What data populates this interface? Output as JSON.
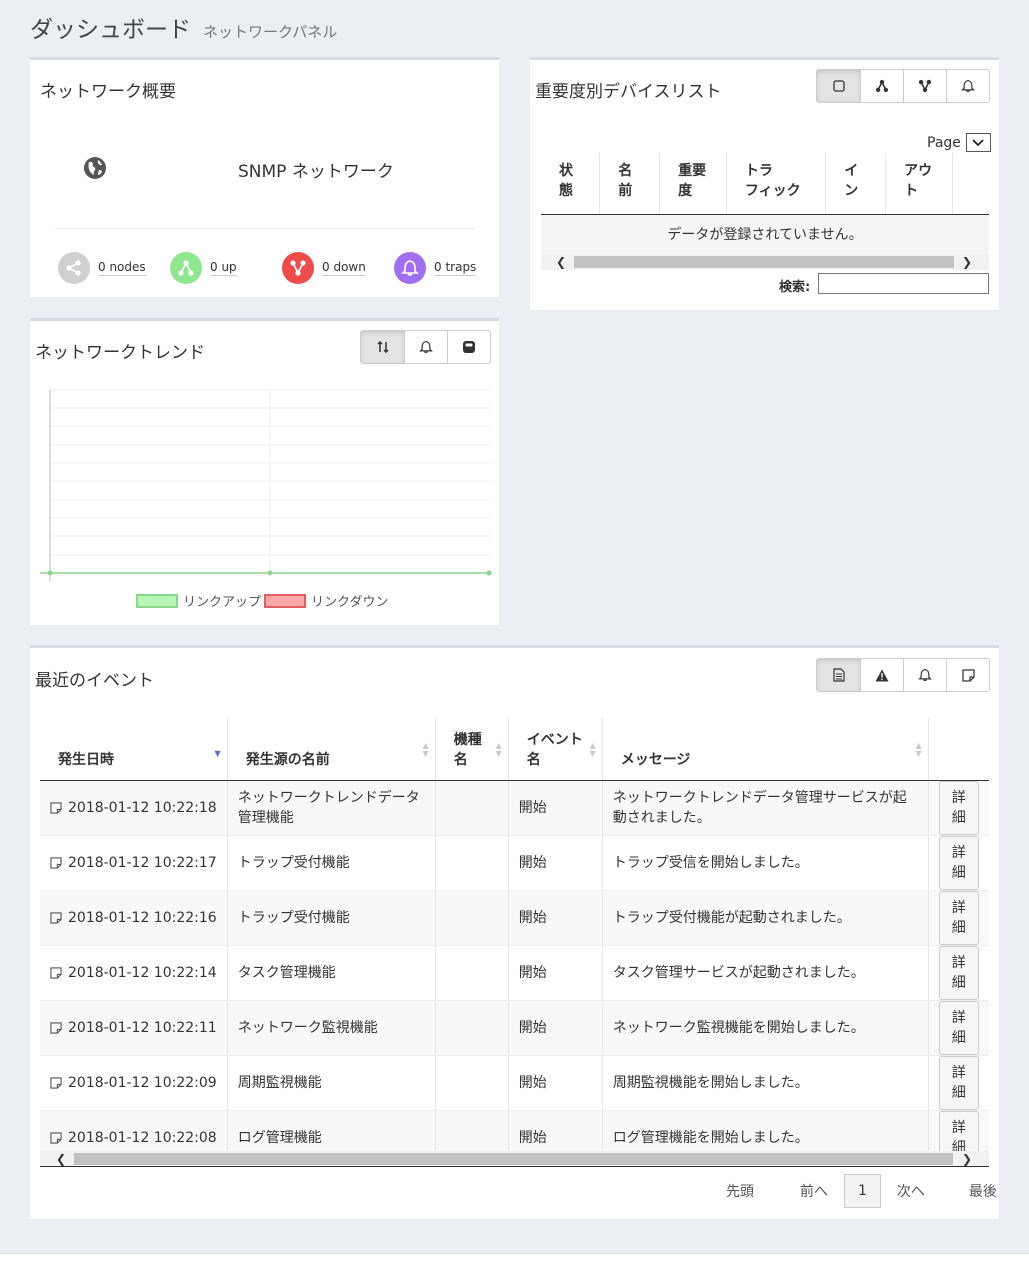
{
  "header": {
    "title": "ダッシュボード",
    "subtitle": "ネットワークパネル"
  },
  "overview": {
    "title": "ネットワーク概要",
    "network_label": "SNMP ネットワーク",
    "stats": [
      {
        "label": "0 nodes",
        "color": "#d0d0d0",
        "icon": "nodes-icon"
      },
      {
        "label": "0 up",
        "color": "#8ee68e",
        "icon": "up-icon"
      },
      {
        "label": "0 down",
        "color": "#f04b4b",
        "icon": "down-icon"
      },
      {
        "label": "0 traps",
        "color": "#a06ef0",
        "icon": "bell-icon"
      }
    ]
  },
  "devices": {
    "title": "重要度別デバイスリスト",
    "page_label": "Page",
    "columns": [
      "状態",
      "名前",
      "重要度",
      "トラフィック",
      "イン",
      "アウト"
    ],
    "empty_text": "データが登録されていません。",
    "search_label": "検索:"
  },
  "trend": {
    "title": "ネットワークトレンド",
    "legend": [
      {
        "label": "リンクアップ",
        "color": "#b6f5b6",
        "border": "#8ad68a"
      },
      {
        "label": "リンクダウン",
        "color": "#f8a8a8",
        "border": "#e06060"
      }
    ]
  },
  "events": {
    "title": "最近のイベント",
    "columns": [
      "発生日時",
      "発生源の名前",
      "機種名",
      "イベント名",
      "メッセージ",
      ""
    ],
    "rows": [
      {
        "date": "2018-01-12 10:22:18",
        "source": "ネットワークトレンドデータ管理機能",
        "model": "",
        "event": "開始",
        "message": "ネットワークトレンドデータ管理サービスが起動されました。"
      },
      {
        "date": "2018-01-12 10:22:17",
        "source": "トラップ受付機能",
        "model": "",
        "event": "開始",
        "message": "トラップ受信を開始しました。"
      },
      {
        "date": "2018-01-12 10:22:16",
        "source": "トラップ受付機能",
        "model": "",
        "event": "開始",
        "message": "トラップ受付機能が起動されました。"
      },
      {
        "date": "2018-01-12 10:22:14",
        "source": "タスク管理機能",
        "model": "",
        "event": "開始",
        "message": "タスク管理サービスが起動されました。"
      },
      {
        "date": "2018-01-12 10:22:11",
        "source": "ネットワーク監視機能",
        "model": "",
        "event": "開始",
        "message": "ネットワーク監視機能を開始しました。"
      },
      {
        "date": "2018-01-12 10:22:09",
        "source": "周期監視機能",
        "model": "",
        "event": "開始",
        "message": "周期監視機能を開始しました。"
      },
      {
        "date": "2018-01-12 10:22:08",
        "source": "ログ管理機能",
        "model": "",
        "event": "開始",
        "message": "ログ管理機能を開始しました。"
      }
    ],
    "detail_label": "詳細",
    "pager": {
      "first": "先頭",
      "prev": "前へ",
      "current": "1",
      "next": "次へ",
      "last": "最後"
    }
  }
}
